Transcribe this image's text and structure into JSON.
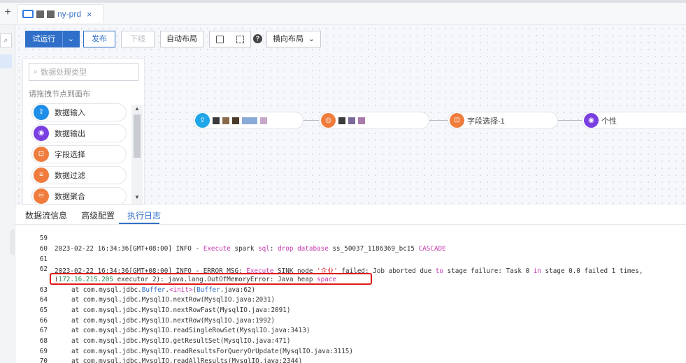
{
  "tab": {
    "title": "ny-prd",
    "close": "×"
  },
  "new_tab": "+",
  "toolbar": {
    "run": "试运行",
    "run_dropdown": "⌄",
    "publish": "发布",
    "offline": "下线",
    "auto_layout": "自动布局",
    "help": "?",
    "layout_select": "横向布局",
    "layout_chevron": "⌄"
  },
  "palette": {
    "search_placeholder": "数据处理类型",
    "hint": "请拖拽节点到画布",
    "items": [
      {
        "label": "数据输入",
        "color": "#1f8ee8"
      },
      {
        "label": "数据输出",
        "color": "#7a3fe0"
      },
      {
        "label": "字段选择",
        "color": "#ef7c3c"
      },
      {
        "label": "数据过滤",
        "color": "#ef7c3c"
      },
      {
        "label": "数据聚合",
        "color": "#ef7c3c"
      }
    ]
  },
  "flow": {
    "nodes": [
      {
        "label": "",
        "color": "#1fa6e8"
      },
      {
        "label": "",
        "color": "#ef7c3c"
      },
      {
        "label": "字段选择-1",
        "color": "#ef7c3c"
      },
      {
        "label": "个性",
        "color": "#7a3fe0"
      }
    ]
  },
  "bottom_tabs": [
    "数据流信息",
    "高级配置",
    "执行日志"
  ],
  "log": {
    "lines": [
      {
        "n": "59"
      },
      {
        "n": "60"
      },
      {
        "n": "61"
      },
      {
        "n": "62"
      },
      {
        "n": "63"
      },
      {
        "n": "64"
      },
      {
        "n": "65"
      },
      {
        "n": "66"
      },
      {
        "n": "67"
      },
      {
        "n": "68"
      },
      {
        "n": "69"
      },
      {
        "n": "70"
      }
    ],
    "l60": {
      "ts": "2023-02-22 16:34:36[GMT+08:00] INFO - ",
      "kw": "Execute",
      "rest1": " spark ",
      "kw2": "sql",
      "rest2": ": ",
      "kw3": "drop database",
      "rest3": " ss_50037_1186369_bc15 ",
      "kw4": "CASCADE"
    },
    "l62": {
      "ts": "2023-02-22 16:34:36[GMT+08:00] INFO - ERROR MSG: ",
      "kw": "Execute",
      "rest1": " SINK node ",
      "red": "'企业'",
      "rest2": " failed: Job aborted due ",
      "kw2": "to",
      "rest3": " stage failure: Task 0 ",
      "kw3": "in",
      "rest4": " stage 0.0 failed 1 times,"
    },
    "l62b": {
      "p": "(",
      "ip": "172.16.215.205",
      "rest": " executor 2): java.lang.OutOfMemoryError: Java heap ",
      "kw": "space"
    },
    "l63": {
      "pre": "at com.mysql.jdbc.",
      "cls": "Buffer",
      "dot": ".",
      "init": "<init>",
      "paren": "(",
      "cls2": "Buffer",
      "tail": ".java:62)"
    },
    "stack": [
      "at com.mysql.jdbc.MysqlIO.nextRow(MysqlIO.java:2031)",
      "at com.mysql.jdbc.MysqlIO.nextRowFast(MysqlIO.java:2091)",
      "at com.mysql.jdbc.MysqlIO.nextRow(MysqlIO.java:1992)",
      "at com.mysql.jdbc.MysqlIO.readSingleRowSet(MysqlIO.java:3413)",
      "at com.mysql.jdbc.MysqlIO.getResultSet(MysqlIO.java:471)",
      "at com.mysql.jdbc.MysqlIO.readResultsForQueryOrUpdate(MysqlIO.java:3115)",
      "at com.mysql.jdbc.MysqlIO.readAllResults(MysqlIO.java:2344)"
    ]
  }
}
